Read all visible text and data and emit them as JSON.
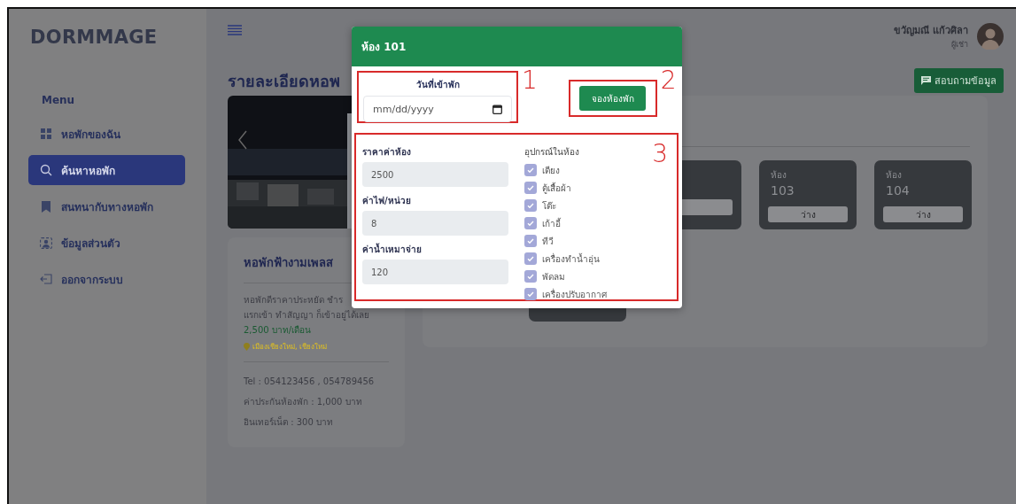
{
  "brand": "DORMMAGE",
  "sidebar": {
    "heading": "Menu",
    "items": [
      {
        "label": "หอพักของฉัน",
        "selected": false
      },
      {
        "label": "ค้นหาหอพัก",
        "selected": true
      },
      {
        "label": "สนทนากับทางหอพัก",
        "selected": false
      },
      {
        "label": "ข้อมูลส่วนตัว",
        "selected": false
      },
      {
        "label": "ออกจากระบบ",
        "selected": false
      }
    ]
  },
  "user": {
    "name": "ขวัญมณี แก้วศิลา",
    "role": "ผู้เช่า"
  },
  "page_title": "รายละเอียดหอพ",
  "inquiry_button": "สอบถามข้อมูล",
  "dorm": {
    "name": "หอพักฟ้างามเพลส",
    "description": [
      "หอพักดีราคาประหยัด ชำร",
      "แรกเข้า ทำสัญญา ก็เข้าอยู่ได้เลย"
    ],
    "price": "2,500 บาท/เดือน",
    "location": "เมืองเชียงใหม่, เชียงใหม่",
    "details": [
      "Tel : 054123456 , 054789456",
      "ค่าประกันห้องพัก : 1,000 บาท",
      "อินเทอร์เน็ต : 300 บาท"
    ]
  },
  "rooms": [
    {
      "label": "ห้อง",
      "number": "103",
      "status": "ว่าง"
    },
    {
      "label": "ห้อง",
      "number": "104",
      "status": "ว่าง"
    }
  ],
  "modal": {
    "title": "ห้อง 101",
    "date_label": "วันที่เข้าพัก",
    "date_placeholder": "mm/dd/yyyy",
    "book_button": "จองห้องพัก",
    "fields": [
      {
        "label": "ราคาค่าห้อง",
        "value": "2500"
      },
      {
        "label": "ค่าไฟ/หน่วย",
        "value": "8"
      },
      {
        "label": "ค่าน้ำเหมาจ่าย",
        "value": "120"
      }
    ],
    "amenities_title": "อุปกรณ์ในห้อง",
    "amenities": [
      {
        "label": "เตียง",
        "checked": true
      },
      {
        "label": "ตู้เสื้อผ้า",
        "checked": true
      },
      {
        "label": "โต๊ะ",
        "checked": true
      },
      {
        "label": "เก้าอี้",
        "checked": true
      },
      {
        "label": "ทีวี",
        "checked": true
      },
      {
        "label": "เครื่องทำน้ำอุ่น",
        "checked": true
      },
      {
        "label": "พัดลม",
        "checked": true
      },
      {
        "label": "เครื่องปรับอากาศ",
        "checked": true
      }
    ]
  },
  "annotations": [
    {
      "label": "1"
    },
    {
      "label": "2"
    },
    {
      "label": "3"
    }
  ]
}
